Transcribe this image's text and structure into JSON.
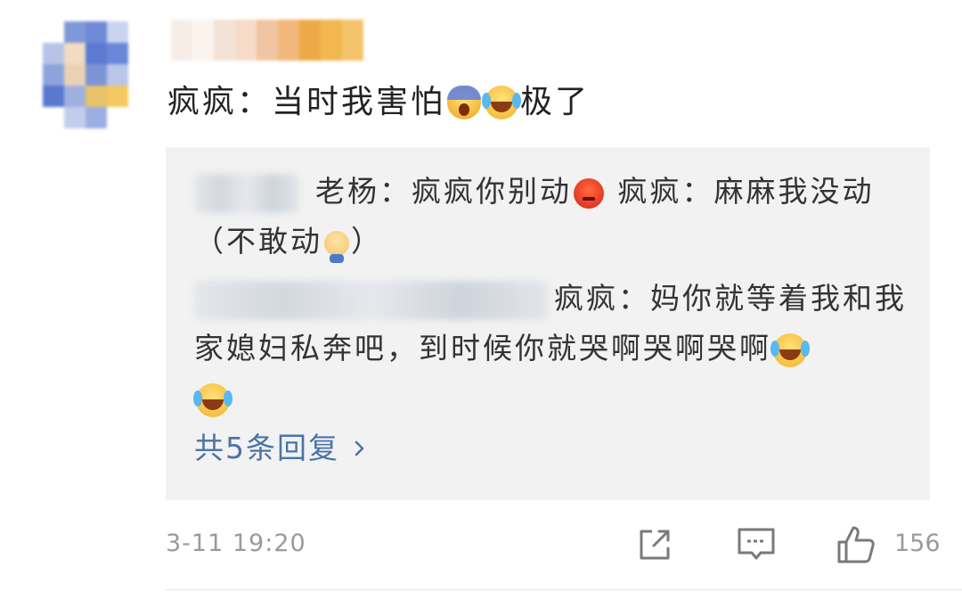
{
  "comment": {
    "text_before_emoji": "疯疯：当时我害怕",
    "emoji_1": "scream-emoji",
    "emoji_2": "laugh-cry-emoji",
    "text_after_emoji": "极了"
  },
  "replies": [
    {
      "text_a": "老杨：疯疯你别动",
      "emoji_a": "angry-emoji",
      "text_b": "疯疯：麻麻我没动（不敢动",
      "emoji_b": "shy-kid-emoji",
      "text_c": "）"
    },
    {
      "text_a": "疯疯：妈你就等着我和我家媳妇私奔吧，到时候你就哭啊哭啊哭啊",
      "emoji_a": "laugh-cry-emoji",
      "emoji_b": "laugh-cry-emoji"
    }
  ],
  "more_replies_label": "共5条回复",
  "footer": {
    "timestamp": "3-11 19:20",
    "like_count": "156"
  },
  "colors": {
    "link_blue": "#4a74a6",
    "meta_gray": "#9a9a9a",
    "reply_bg": "#f2f2f2"
  }
}
